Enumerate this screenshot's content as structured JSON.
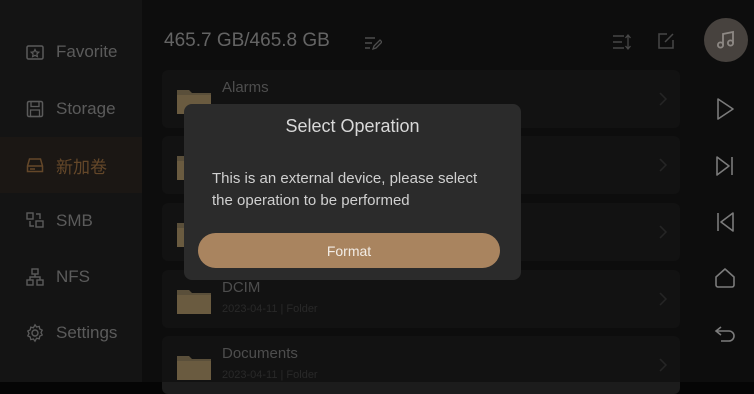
{
  "sidebar": {
    "items": [
      {
        "label": "Favorite",
        "icon": "star-folder-icon"
      },
      {
        "label": "Storage",
        "icon": "floppy-disk-icon"
      },
      {
        "label": "新加卷",
        "icon": "drive-icon",
        "active": true
      },
      {
        "label": "SMB",
        "icon": "network-share-icon"
      },
      {
        "label": "NFS",
        "icon": "network-tree-icon"
      },
      {
        "label": "Settings",
        "icon": "gear-icon"
      }
    ]
  },
  "header": {
    "storage": "465.7 GB/465.8 GB"
  },
  "files": [
    {
      "name": "Alarms",
      "meta": ""
    },
    {
      "name": "",
      "meta": ""
    },
    {
      "name": "",
      "meta": ""
    },
    {
      "name": "DCIM",
      "meta": "2023-04-11 | Folder"
    },
    {
      "name": "Documents",
      "meta": "2023-04-11 | Folder"
    }
  ],
  "dialog": {
    "title": "Select Operation",
    "message": "This is an external device, please select the operation to be performed",
    "button": "Format"
  },
  "colors": {
    "accent": "#a9845f",
    "active_text": "#9a6e40",
    "dialog_bg": "#2b2b2b"
  }
}
